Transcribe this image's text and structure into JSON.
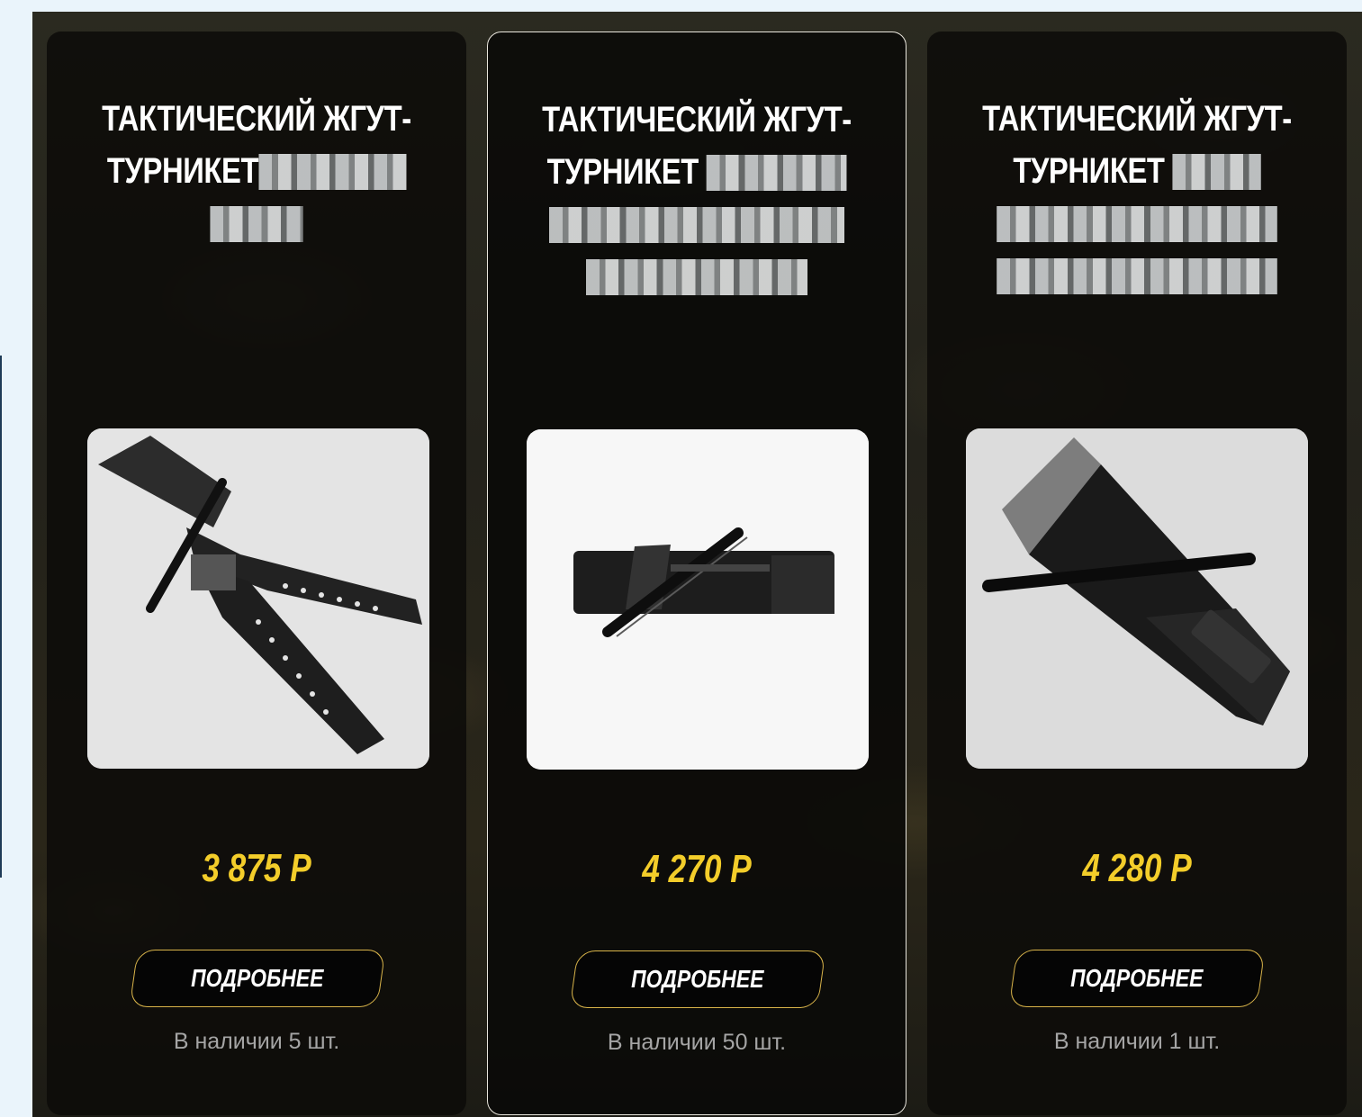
{
  "products": [
    {
      "title_line1": "ТАКТИЧЕСКИЙ ЖГУТ-",
      "title_line2": "ТУРНИКЕТ",
      "price": "3 875 Р",
      "button_label": "ПОДРОБНЕЕ",
      "stock": "В наличии 5 шт."
    },
    {
      "title_line1": "ТАКТИЧЕСКИЙ ЖГУТ-",
      "title_line2": "ТУРНИКЕТ",
      "price": "4 270 Р",
      "button_label": "ПОДРОБНЕЕ",
      "stock": "В наличии 50 шт."
    },
    {
      "title_line1": "ТАКТИЧЕСКИЙ ЖГУТ-",
      "title_line2": "ТУРНИКЕТ",
      "price": "4 280 Р",
      "button_label": "ПОДРОБНЕЕ",
      "stock": "В наличии 1 шт."
    }
  ],
  "colors": {
    "price": "#f3cd2a",
    "button_border": "#d9b44a",
    "card_bg": "#0c0b09",
    "stock_text": "#a5a5a5"
  }
}
